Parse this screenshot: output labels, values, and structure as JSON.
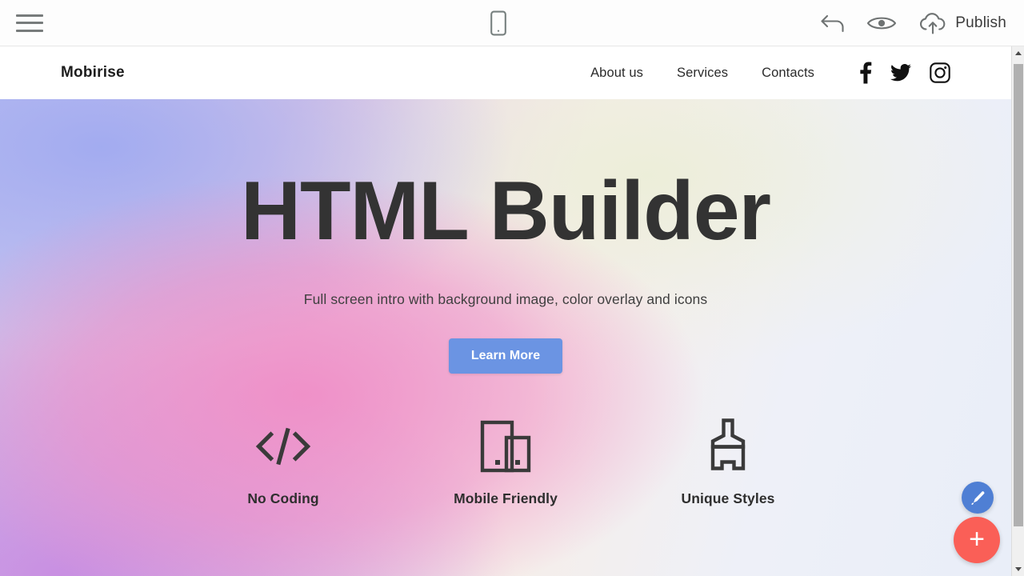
{
  "toolbar": {
    "menu_icon": "hamburger-menu-icon",
    "device_icon": "mobile-device-icon",
    "undo_icon": "undo-arrow-icon",
    "preview_icon": "eye-preview-icon",
    "publish_icon": "cloud-upload-icon",
    "publish_label": "Publish"
  },
  "site": {
    "brand": "Mobirise",
    "nav_links": [
      {
        "label": "About us"
      },
      {
        "label": "Services"
      },
      {
        "label": "Contacts"
      }
    ],
    "social": [
      {
        "name": "facebook-icon"
      },
      {
        "name": "twitter-icon"
      },
      {
        "name": "instagram-icon"
      }
    ],
    "hero": {
      "title": "HTML Builder",
      "subtitle": "Full screen intro with background image, color overlay and icons",
      "cta_label": "Learn More",
      "features": [
        {
          "icon": "code-brackets-icon",
          "label": "No Coding",
          "glyph": "</>"
        },
        {
          "icon": "devices-icon",
          "label": "Mobile Friendly"
        },
        {
          "icon": "paint-brush-icon",
          "label": "Unique Styles"
        }
      ]
    }
  },
  "fabs": {
    "edit_icon": "pen-brush-icon",
    "add_icon": "plus-icon",
    "add_label": "+"
  },
  "colors": {
    "cta_blue": "#6b94e3",
    "fab_edit_blue": "#4f7fd4",
    "fab_add_red": "#fa5f57",
    "text_dark": "#333333",
    "gradient_left_top": "#b6bdf0",
    "gradient_pink": "#f08cc6",
    "gradient_purple": "#c88ce1",
    "gradient_cream": "#f6eee8",
    "gradient_right": "#e9eef8"
  }
}
